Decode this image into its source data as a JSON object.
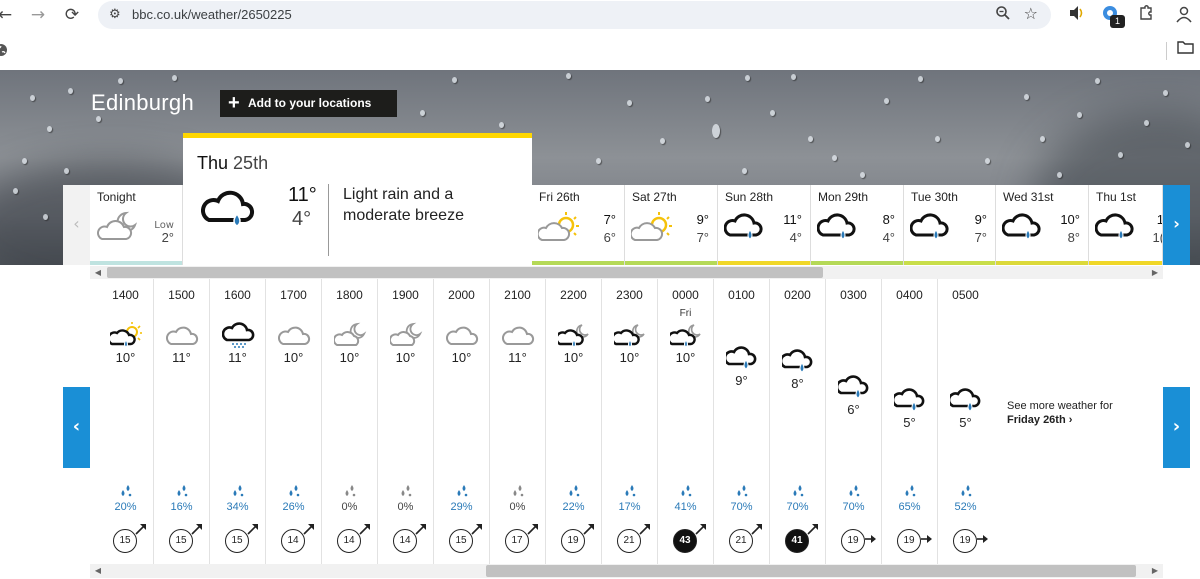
{
  "browser": {
    "url": "bbc.co.uk/weather/2650225",
    "back": "←",
    "forward": "→",
    "reload": "⟳",
    "zoom_icon": "🔍",
    "star_icon": "☆",
    "ext_badge": "1"
  },
  "location": {
    "name": "Edinburgh",
    "add_label": "Add to your locations",
    "plus": "+"
  },
  "selected_day": {
    "day": "Thu",
    "date": "25th",
    "high": "11°",
    "low": "4°",
    "description": "Light rain and a moderate breeze",
    "icon": "light-rain-icon"
  },
  "days": [
    {
      "name": "Tonight",
      "low_label": "Low",
      "low": "2°",
      "icon": "partly-cloudy-night-icon",
      "bar": "#bfe3e0"
    },
    {
      "name": "Fri 26th",
      "high": "7°",
      "low": "6°",
      "icon": "sunny-intervals-icon",
      "bar": "#b5d957"
    },
    {
      "name": "Sat 27th",
      "high": "9°",
      "low": "7°",
      "icon": "sunny-intervals-icon",
      "bar": "#b5d957"
    },
    {
      "name": "Sun 28th",
      "high": "11°",
      "low": "4°",
      "icon": "light-rain-icon",
      "bar": "#f0d728"
    },
    {
      "name": "Mon 29th",
      "high": "8°",
      "low": "4°",
      "icon": "light-rain-icon",
      "bar": "#b5d957"
    },
    {
      "name": "Tue 30th",
      "high": "9°",
      "low": "7°",
      "icon": "light-rain-icon",
      "bar": "#c9de4a"
    },
    {
      "name": "Wed 31st",
      "high": "10°",
      "low": "8°",
      "icon": "light-rain-icon",
      "bar": "#dcd93a"
    },
    {
      "name": "Thu 1st",
      "high": "1",
      "low": "1(",
      "icon": "light-rain-icon",
      "bar": "#f0d728"
    }
  ],
  "hours": [
    {
      "time": "1400",
      "icon": "light-rain-sun-icon",
      "temp": "10°",
      "rain": "20%",
      "wind": "15",
      "dark": false,
      "dir": "ne",
      "rain_color": "#2a7ab8",
      "drops": "blue"
    },
    {
      "time": "1500",
      "icon": "cloud-icon",
      "temp": "11°",
      "rain": "16%",
      "wind": "15",
      "dark": false,
      "dir": "ne",
      "rain_color": "#2a7ab8",
      "drops": "blue"
    },
    {
      "time": "1600",
      "icon": "drizzle-icon",
      "temp": "11°",
      "rain": "34%",
      "wind": "15",
      "dark": false,
      "dir": "ne",
      "rain_color": "#2a7ab8",
      "drops": "blue"
    },
    {
      "time": "1700",
      "icon": "cloud-icon",
      "temp": "10°",
      "rain": "26%",
      "wind": "14",
      "dark": false,
      "dir": "ne",
      "rain_color": "#2a7ab8",
      "drops": "blue"
    },
    {
      "time": "1800",
      "icon": "partly-cloudy-night-icon",
      "temp": "10°",
      "rain": "0%",
      "wind": "14",
      "dark": false,
      "dir": "ne",
      "rain_color": "#444444",
      "drops": "grey"
    },
    {
      "time": "1900",
      "icon": "partly-cloudy-night-icon",
      "temp": "10°",
      "rain": "0%",
      "wind": "14",
      "dark": false,
      "dir": "ne",
      "rain_color": "#444444",
      "drops": "grey"
    },
    {
      "time": "2000",
      "icon": "cloud-icon",
      "temp": "10°",
      "rain": "29%",
      "wind": "15",
      "dark": false,
      "dir": "ne",
      "rain_color": "#2a7ab8",
      "drops": "blue"
    },
    {
      "time": "2100",
      "icon": "cloud-icon",
      "temp": "11°",
      "rain": "0%",
      "wind": "17",
      "dark": false,
      "dir": "ne",
      "rain_color": "#444444",
      "drops": "grey"
    },
    {
      "time": "2200",
      "icon": "light-rain-night-icon",
      "temp": "10°",
      "rain": "22%",
      "wind": "19",
      "dark": false,
      "dir": "ne",
      "rain_color": "#2a7ab8",
      "drops": "blue"
    },
    {
      "time": "2300",
      "icon": "light-rain-night-icon",
      "temp": "10°",
      "rain": "17%",
      "wind": "21",
      "dark": false,
      "dir": "ne",
      "rain_color": "#2a7ab8",
      "drops": "blue"
    },
    {
      "time": "0000",
      "sub": "Fri",
      "icon": "light-rain-night-icon",
      "temp": "10°",
      "rain": "41%",
      "wind": "43",
      "dark": true,
      "dir": "ne",
      "rain_color": "#2a7ab8",
      "drops": "blue"
    },
    {
      "time": "0100",
      "icon": "light-rain-icon",
      "temp": "9°",
      "rain": "70%",
      "wind": "21",
      "dark": false,
      "dir": "ne",
      "rain_color": "#2a7ab8",
      "drops": "blue"
    },
    {
      "time": "0200",
      "icon": "light-rain-icon",
      "temp": "8°",
      "rain": "70%",
      "wind": "41",
      "dark": true,
      "dir": "ne",
      "rain_color": "#2a7ab8",
      "drops": "blue"
    },
    {
      "time": "0300",
      "icon": "light-rain-icon",
      "temp": "6°",
      "rain": "70%",
      "wind": "19",
      "dark": false,
      "dir": "e",
      "rain_color": "#2a7ab8",
      "drops": "blue"
    },
    {
      "time": "0400",
      "icon": "light-rain-icon",
      "temp": "5°",
      "rain": "65%",
      "wind": "19",
      "dark": false,
      "dir": "e",
      "rain_color": "#2a7ab8",
      "drops": "blue"
    },
    {
      "time": "0500",
      "icon": "light-rain-icon",
      "temp": "5°",
      "rain": "52%",
      "wind": "19",
      "dark": false,
      "dir": "e",
      "rain_color": "#2a7ab8",
      "drops": "blue"
    }
  ],
  "see_more": {
    "line1": "See more weather for",
    "line2": "Friday 26th ›"
  },
  "nav": {
    "prev": "‹",
    "next": "›"
  },
  "colors": {
    "accent": "#1a8fd6",
    "selected_bar": "#ffd700",
    "rain_blue": "#2a7ab8",
    "sun": "#f5c20b"
  }
}
